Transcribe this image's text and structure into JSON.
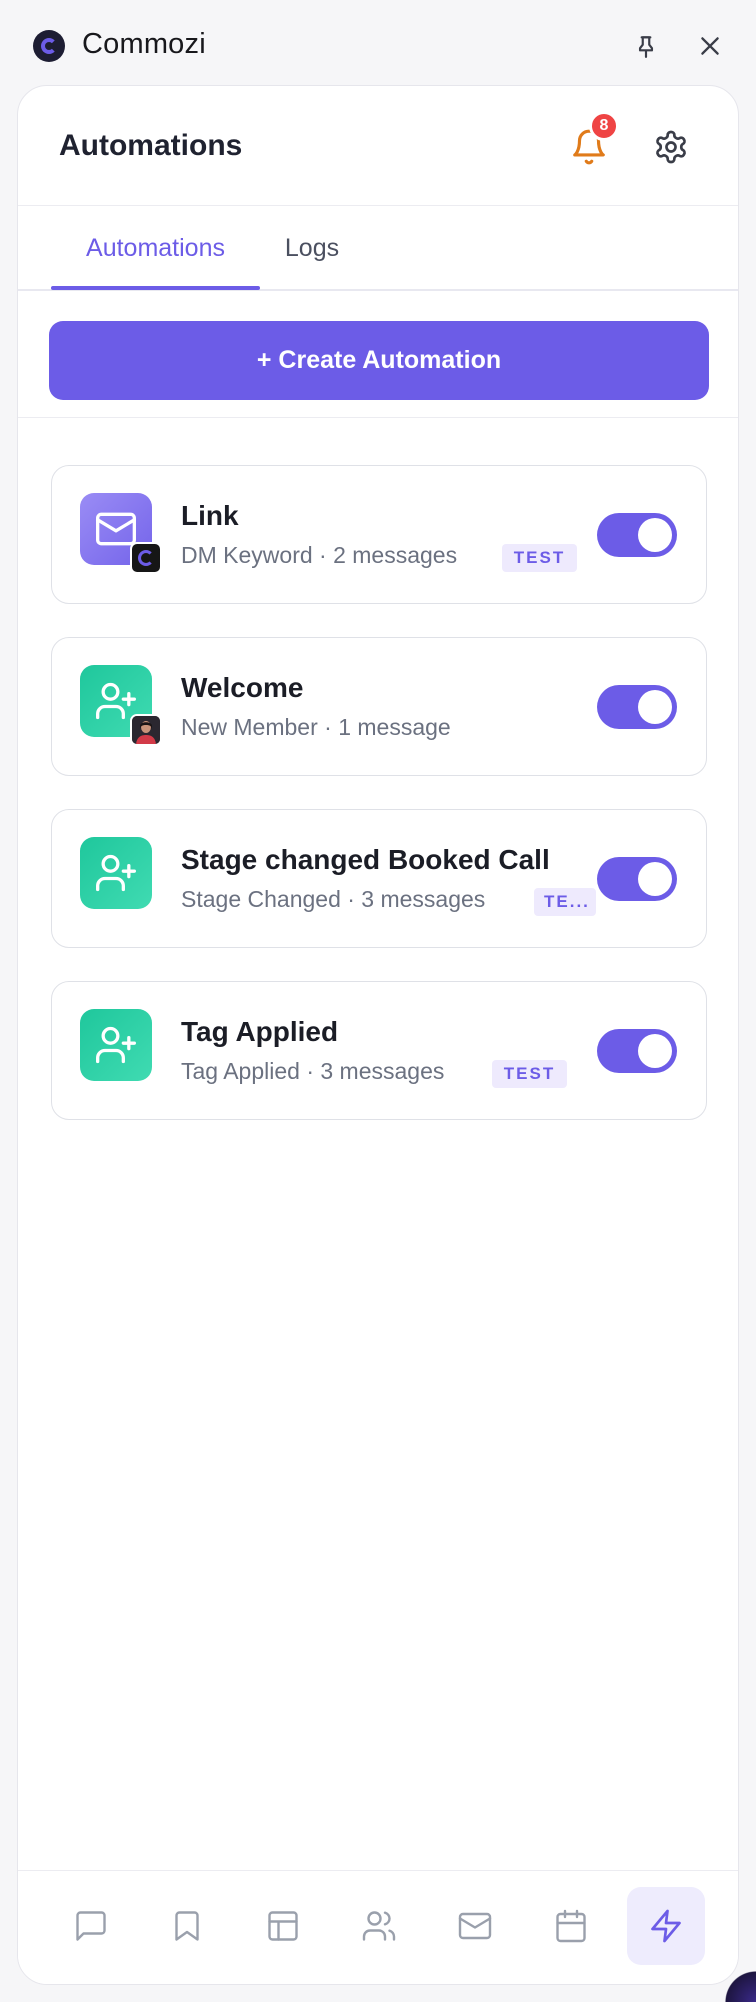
{
  "app": {
    "title": "Commozi"
  },
  "titlebar": {
    "pin_icon": "pin-icon",
    "close_icon": "close-icon"
  },
  "header": {
    "title": "Automations",
    "notification_count": "8",
    "bell_icon": "bell-icon",
    "settings_icon": "gear-icon"
  },
  "tabs": [
    {
      "label": "Automations",
      "active": true
    },
    {
      "label": "Logs",
      "active": false
    }
  ],
  "create_button": {
    "label": "+ Create Automation"
  },
  "automations": [
    {
      "title": "Link",
      "subtitle": "DM Keyword · 2 messages",
      "badge": "TEST",
      "icon": "mail-icon",
      "sub_icon": "brand-logo",
      "enabled": true
    },
    {
      "title": "Welcome",
      "subtitle": "New Member · 1 message",
      "badge": "",
      "icon": "user-plus-icon",
      "sub_icon": "avatar",
      "enabled": true
    },
    {
      "title": "Stage changed Booked Call",
      "subtitle": "Stage Changed · 3 messages",
      "badge": "TE...",
      "icon": "user-plus-icon",
      "sub_icon": "",
      "enabled": true
    },
    {
      "title": "Tag Applied",
      "subtitle": "Tag Applied · 3 messages",
      "badge": "TEST",
      "icon": "user-plus-icon",
      "sub_icon": "",
      "enabled": true
    }
  ],
  "bottom_nav": [
    {
      "icon": "chat-icon",
      "active": false
    },
    {
      "icon": "bookmark-icon",
      "active": false
    },
    {
      "icon": "layout-icon",
      "active": false
    },
    {
      "icon": "users-icon",
      "active": false
    },
    {
      "icon": "mail-icon",
      "active": false
    },
    {
      "icon": "calendar-icon",
      "active": false
    },
    {
      "icon": "lightning-icon",
      "active": true
    }
  ],
  "colors": {
    "accent": "#6c5ce7",
    "bell": "#e07b1a",
    "badge": "#ef4444",
    "green_icon": "#1fc79c",
    "purple_icon": "#8676ef"
  }
}
